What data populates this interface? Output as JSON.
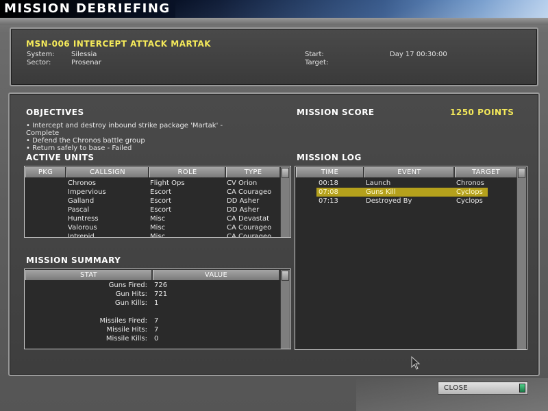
{
  "window": {
    "title": "MISSION DEBRIEFING"
  },
  "mission": {
    "title": "MSN-006 INTERCEPT ATTACK MARTAK",
    "system_label": "System:",
    "system_value": "Silessia",
    "sector_label": "Sector:",
    "sector_value": "Prosenar",
    "start_label": "Start:",
    "start_value": "Day 17 00:30:00",
    "target_label": "Target:",
    "target_value": ""
  },
  "objectives": {
    "heading": "OBJECTIVES",
    "items": [
      "• Intercept and destroy inbound strike package 'Martak' -",
      "Complete",
      "• Defend the Chronos battle group",
      "• Return safely to base - Failed"
    ]
  },
  "score": {
    "label": "MISSION SCORE",
    "value": "1250 POINTS"
  },
  "active_units": {
    "heading": "ACTIVE UNITS",
    "columns": [
      "PKG",
      "CALLSIGN",
      "ROLE",
      "TYPE"
    ],
    "rows": [
      {
        "pkg": "",
        "callsign": "Chronos",
        "role": "Flight Ops",
        "type": "CV Orion"
      },
      {
        "pkg": "",
        "callsign": "Impervious",
        "role": "Escort",
        "type": "CA Courageo"
      },
      {
        "pkg": "",
        "callsign": "Galland",
        "role": "Escort",
        "type": "DD Asher"
      },
      {
        "pkg": "",
        "callsign": "Pascal",
        "role": "Escort",
        "type": "DD Asher"
      },
      {
        "pkg": "",
        "callsign": "Huntress",
        "role": "Misc",
        "type": "CA Devastat"
      },
      {
        "pkg": "",
        "callsign": "Valorous",
        "role": "Misc",
        "type": "CA Courageo"
      },
      {
        "pkg": "",
        "callsign": "Intrepid",
        "role": "Misc",
        "type": "CA Courageo"
      }
    ]
  },
  "mission_log": {
    "heading": "MISSION LOG",
    "columns": [
      "TIME",
      "EVENT",
      "TARGET"
    ],
    "rows": [
      {
        "time": "00:18",
        "event": "Launch",
        "target": "Chronos",
        "selected": false
      },
      {
        "time": "07:08",
        "event": "Guns Kill",
        "target": "Cyclops",
        "selected": true
      },
      {
        "time": "07:13",
        "event": "Destroyed By",
        "target": "Cyclops",
        "selected": false
      }
    ]
  },
  "summary": {
    "heading": "MISSION SUMMARY",
    "columns": [
      "STAT",
      "VALUE"
    ],
    "rows": [
      {
        "stat": "Guns Fired:",
        "value": "726"
      },
      {
        "stat": "Gun Hits:",
        "value": "721"
      },
      {
        "stat": "Gun Kills:",
        "value": "1"
      },
      {
        "stat": "",
        "value": ""
      },
      {
        "stat": "Missiles Fired:",
        "value": "7"
      },
      {
        "stat": "Missile Hits:",
        "value": "7"
      },
      {
        "stat": "Missile Kills:",
        "value": "0"
      }
    ]
  },
  "buttons": {
    "close": "CLOSE"
  },
  "colors": {
    "accent_yellow": "#f5ea5a",
    "highlight": "#b5a11c",
    "panel": "#3c3c3c"
  }
}
